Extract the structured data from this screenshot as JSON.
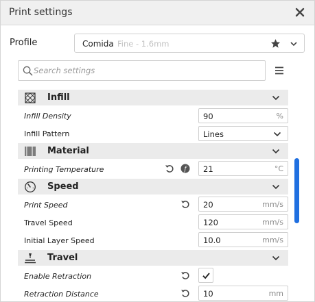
{
  "window": {
    "title": "Print settings"
  },
  "profile": {
    "label": "Profile",
    "name": "Comida",
    "detail": "Fine - 1.6mm"
  },
  "search": {
    "placeholder": "Search settings"
  },
  "categories": {
    "infill": {
      "label": "Infill",
      "icon": "infill-icon"
    },
    "material": {
      "label": "Material",
      "icon": "material-icon"
    },
    "speed": {
      "label": "Speed",
      "icon": "speedometer-icon"
    },
    "travel": {
      "label": "Travel",
      "icon": "travel-icon"
    }
  },
  "settings": {
    "infill_density": {
      "label": "Infill Density",
      "value": "90",
      "unit": "%"
    },
    "infill_pattern": {
      "label": "Infill Pattern",
      "value": "Lines"
    },
    "printing_temperature": {
      "label": "Printing Temperature",
      "value": "21",
      "unit": "°C"
    },
    "print_speed": {
      "label": "Print Speed",
      "value": "20",
      "unit": "mm/s"
    },
    "travel_speed": {
      "label": "Travel Speed",
      "value": "120",
      "unit": "mm/s"
    },
    "initial_layer_speed": {
      "label": "Initial Layer Speed",
      "value": "10.0",
      "unit": "mm/s"
    },
    "enable_retraction": {
      "label": "Enable Retraction",
      "checked": true
    },
    "retraction_distance": {
      "label": "Retraction Distance",
      "value": "10",
      "unit": "mm"
    }
  },
  "colors": {
    "accent": "#1f6fe0",
    "category_bg": "#ebebeb",
    "titlebar_bg": "#f0f0f0"
  }
}
